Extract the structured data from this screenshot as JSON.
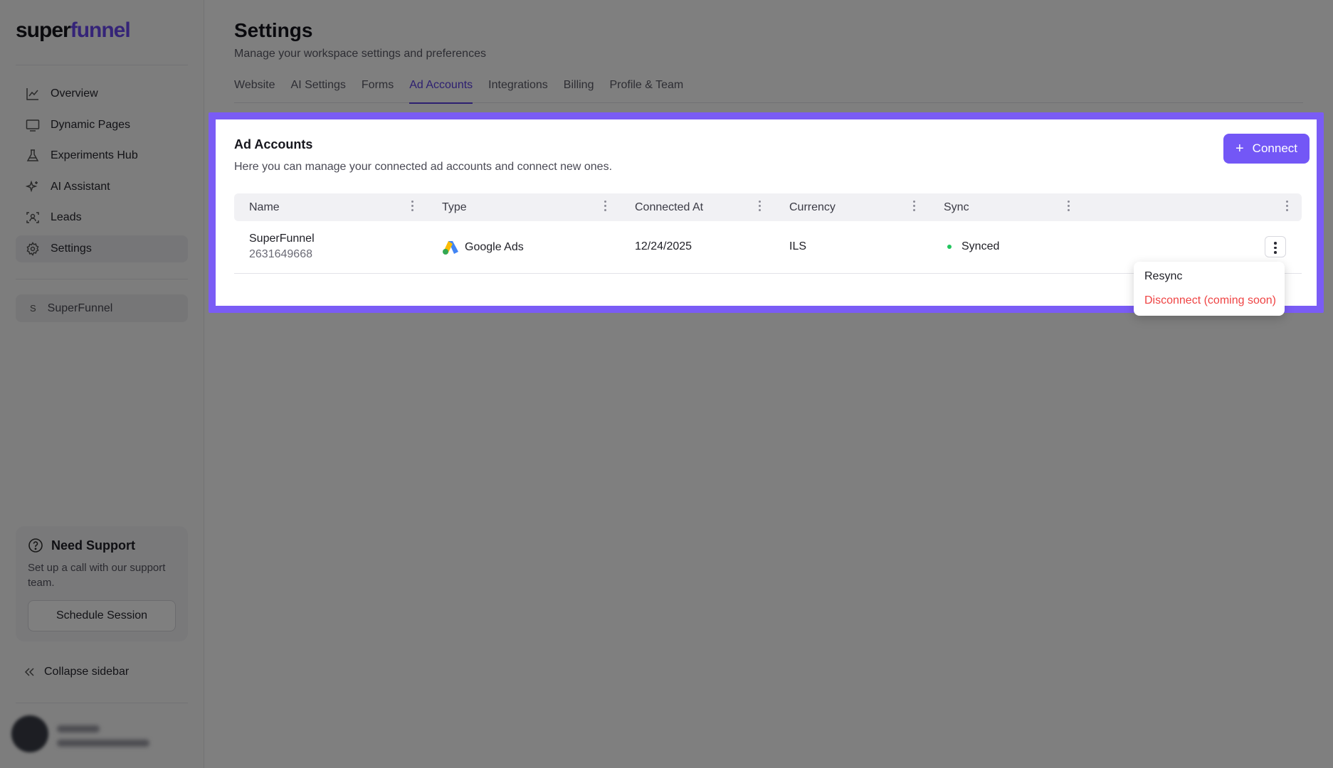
{
  "sidebar": {
    "logo": {
      "part1": "super",
      "part2": "funnel"
    },
    "nav": [
      {
        "label": "Overview",
        "icon": "chart-line-icon"
      },
      {
        "label": "Dynamic Pages",
        "icon": "monitor-icon"
      },
      {
        "label": "Experiments Hub",
        "icon": "flask-icon"
      },
      {
        "label": "AI Assistant",
        "icon": "sparkles-icon"
      },
      {
        "label": "Leads",
        "icon": "user-scan-icon"
      },
      {
        "label": "Settings",
        "icon": "gear-icon",
        "active": true
      }
    ],
    "workspace": {
      "initial": "S",
      "name": "SuperFunnel"
    },
    "support": {
      "title": "Need Support",
      "text": "Set up a call with our support team.",
      "button": "Schedule Session"
    },
    "collapse_label": "Collapse sidebar"
  },
  "page": {
    "title": "Settings",
    "subtitle": "Manage your workspace settings and preferences",
    "tabs": [
      "Website",
      "AI Settings",
      "Forms",
      "Ad Accounts",
      "Integrations",
      "Billing",
      "Profile & Team"
    ],
    "active_tab": "Ad Accounts"
  },
  "card": {
    "title": "Ad Accounts",
    "description": "Here you can manage your connected ad accounts and connect new ones.",
    "connect_button": "Connect",
    "columns": [
      "Name",
      "Type",
      "Connected At",
      "Currency",
      "Sync"
    ],
    "rows": [
      {
        "name": "SuperFunnel",
        "account_id": "2631649668",
        "type": "Google Ads",
        "connected_at": "12/24/2025",
        "currency": "ILS",
        "sync": "Synced"
      }
    ]
  },
  "row_menu": {
    "resync": "Resync",
    "disconnect": "Disconnect (coming soon)"
  },
  "colors": {
    "accent": "#7357f6",
    "highlight_border": "#7a5cf5",
    "sync_status": "#22c55e",
    "danger": "#ef4444"
  }
}
